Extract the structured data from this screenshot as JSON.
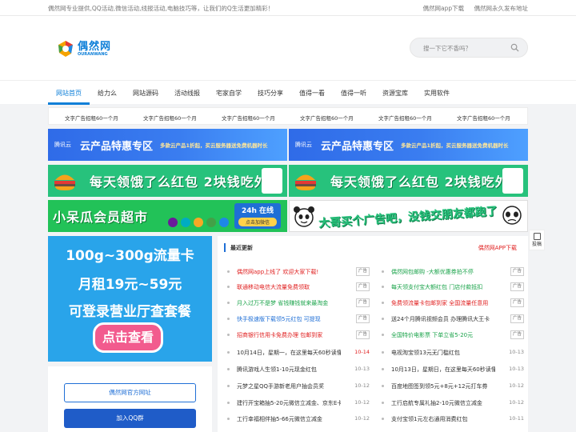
{
  "topbar": {
    "tagline": "偶然网专业提供,QQ活动,微信活动,线报活动,电脑技巧等，让我们的Q生活更加精彩！",
    "links": [
      "偶然网app下载",
      "偶然网永久发布地址"
    ]
  },
  "logo": {
    "cn": "偶然网",
    "en": "OURANWANG"
  },
  "search": {
    "placeholder": "搜一下它不香吗？"
  },
  "nav": {
    "items": [
      "网站首页",
      "给力么",
      "网站源码",
      "活动线报",
      "宅家自学",
      "技巧分享",
      "值得一看",
      "值得一听",
      "资源宝库",
      "实用软件"
    ],
    "active": 0
  },
  "ad_text": [
    "文字广告招租60一个月",
    "文字广告招租60一个月",
    "文字广告招租60一个月",
    "文字广告招租60一个月",
    "文字广告招租60一个月",
    "文字广告招租60一个月"
  ],
  "banners": {
    "cloud": {
      "brand": "腾讯云",
      "title": "云产品特惠专区",
      "sub": "多款云产品1折起，买云服务器送免费机器时长"
    },
    "eleme": {
      "title": "每天领饿了么红包 2块钱吃外卖"
    },
    "xiaoguagua": {
      "title": "小呆瓜会员超市",
      "badge_title": "24h 在线",
      "badge_btn": "点击加微信"
    },
    "panda": {
      "title": "大哥买个广告吧，没钱交朋友都跑了"
    }
  },
  "feedback": {
    "label": "投稿"
  },
  "side_promo": {
    "line1": "100g~300g流量卡",
    "line2": "月租19元~59元",
    "line3": "可登录营业厅查套餐",
    "button": "点击查看"
  },
  "side_buttons": {
    "official": "偶然网官方网址",
    "qq": "加入QQ群"
  },
  "latest": {
    "title": "最近更新",
    "app_link": "偶然网APP下载",
    "ad_label": "广告",
    "left_ads": [
      {
        "text": "偶然网app上线了 欢迎大家下载!",
        "color": "red"
      },
      {
        "text": "联通移动电信大流量免费领取",
        "color": "red"
      },
      {
        "text": "月入过万不是梦 省钱赚钱就来最淘金",
        "color": "green"
      },
      {
        "text": "快手极速版下载领5元红包 可提现",
        "color": "blue"
      },
      {
        "text": "招商银行信用卡免费办理 包邮到家",
        "color": "red"
      }
    ],
    "right_ads": [
      {
        "text": "偶然网包邮购 -大额优惠券拍不停",
        "color": "green"
      },
      {
        "text": "每天领支付宝大额红包 门店付款抵扣",
        "color": "green"
      },
      {
        "text": "免费领流量卡包邮到家 全国流量任意用",
        "color": "red"
      },
      {
        "text": "送24个月腾讯视频会员 办理腾讯大王卡",
        "color": "plain"
      },
      {
        "text": "全国特价电影票 下单立省5-20元",
        "color": "green"
      }
    ],
    "left_news": [
      {
        "text": "10月14日，星期一，在这里每天60秒读懂世界",
        "date": "10-14",
        "red": true
      },
      {
        "text": "腾讯游戏人生领1-10元现金红包",
        "date": "10-13",
        "red": false
      },
      {
        "text": "元梦之星QQ手游新老用户抽会员奖",
        "date": "10-12",
        "red": false
      },
      {
        "text": "建行开宝箱抽5-20元微信立减金、京东E卡",
        "date": "10-12",
        "red": false
      },
      {
        "text": "工行幸福相伴抽5-66元微信立减金",
        "date": "10-12",
        "red": false
      }
    ],
    "right_news": [
      {
        "text": "电视淘宝领13元无门槛红包",
        "date": "10-13"
      },
      {
        "text": "10月13日，星期日，在这里每天60秒读懂世界",
        "date": "10-13"
      },
      {
        "text": "百度地图签到领5元+8元+12元打车券",
        "date": "10-12"
      },
      {
        "text": "工行启航专属礼抽2-10元微信立减金",
        "date": "10-12"
      },
      {
        "text": "支付宝领1元左右通用消费红包",
        "date": "10-11"
      }
    ]
  },
  "colors": {
    "accent": "#0e7fd8",
    "red": "#e02020",
    "green": "#1aa34a",
    "blue": "#1f6fd6"
  }
}
